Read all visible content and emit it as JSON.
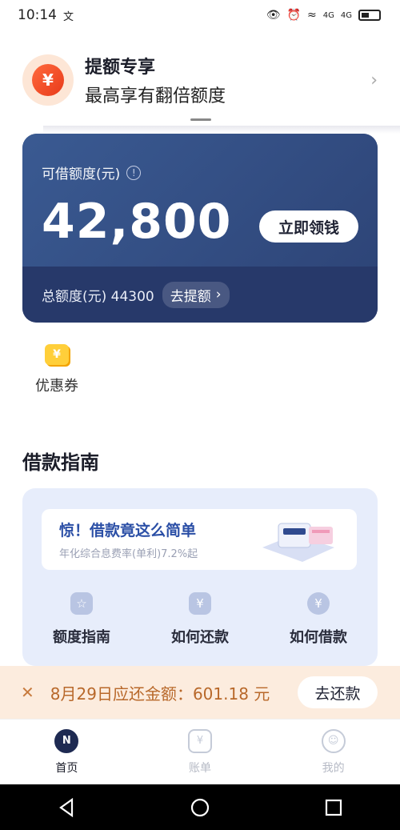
{
  "status": {
    "time": "10:14",
    "extra": "文",
    "net1": "4G",
    "net2": "4G"
  },
  "promo": {
    "title": "提额专享",
    "subtitle": "最高享有翻倍额度",
    "coin_symbol": "¥"
  },
  "credit": {
    "label": "可借额度(元)",
    "amount": "42,800",
    "borrow_button": "立即领钱",
    "total_label": "总额度(元) 44300",
    "raise_button": "去提额"
  },
  "coupon": {
    "label": "优惠券",
    "icon_symbol": "¥"
  },
  "guide": {
    "title": "借款指南",
    "banner_title": "惊！借款竟这么简单",
    "banner_sub": "年化综合息费率(单利)7.2%起",
    "items": [
      {
        "label": "额度指南",
        "icon": "☆"
      },
      {
        "label": "如何还款",
        "icon": "¥"
      },
      {
        "label": "如何借款",
        "icon": "¥"
      }
    ]
  },
  "reminder": {
    "text": "8月29日应还金额：601.18 元",
    "button": "去还款"
  },
  "tabs": [
    {
      "label": "首页",
      "icon": "N"
    },
    {
      "label": "账单",
      "icon": "¥"
    },
    {
      "label": "我的",
      "icon": ""
    }
  ]
}
